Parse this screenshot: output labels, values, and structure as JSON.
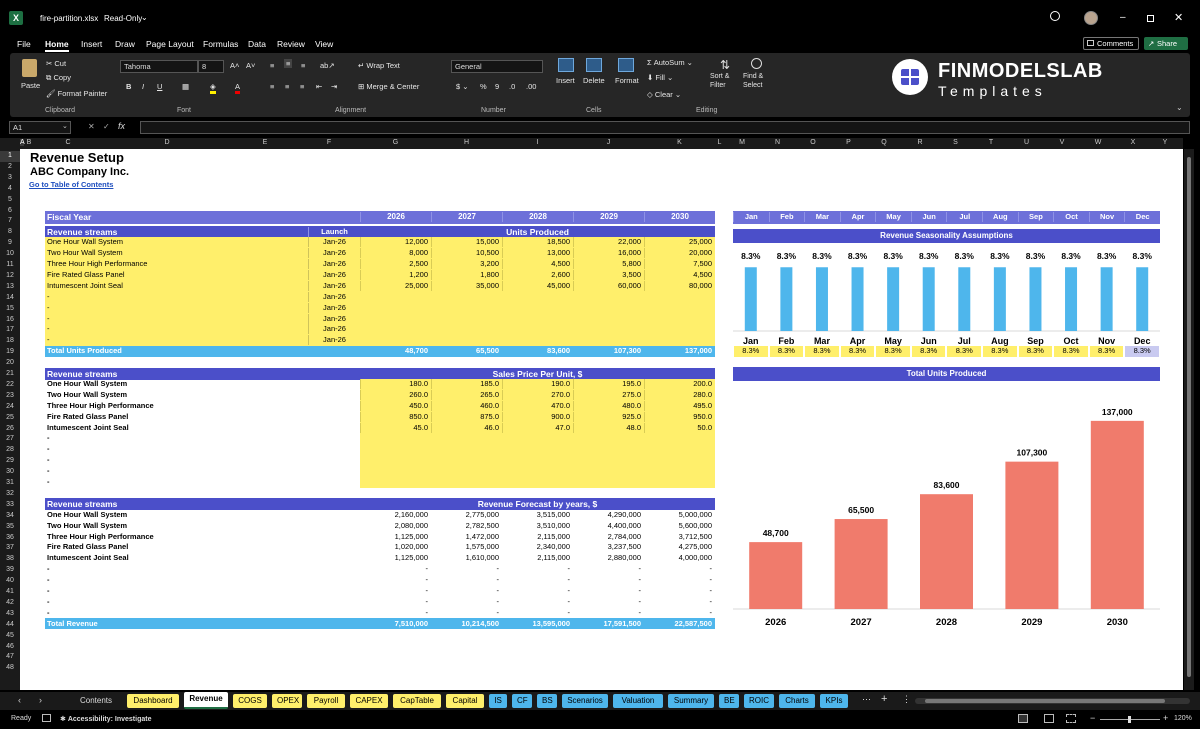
{
  "window": {
    "file_name": "fire-partition.xlsx",
    "mode": "Read-Only"
  },
  "menu": [
    "File",
    "Home",
    "Insert",
    "Draw",
    "Page Layout",
    "Formulas",
    "Data",
    "Review",
    "View"
  ],
  "actions": {
    "comments": "Comments",
    "share": "Share"
  },
  "ribbon": {
    "clipboard": {
      "paste": "Paste",
      "cut": "Cut",
      "copy": "Copy",
      "format_painter": "Format Painter",
      "label": "Clipboard"
    },
    "font": {
      "name": "Tahoma",
      "size": "8",
      "label": "Font"
    },
    "alignment": {
      "wrap_text": "Wrap Text",
      "merge_center": "Merge & Center",
      "label": "Alignment"
    },
    "number": {
      "format": "General",
      "label": "Number"
    },
    "cells": {
      "insert": "Insert",
      "delete": "Delete",
      "format": "Format",
      "label": "Cells"
    },
    "editing": {
      "autosum": "AutoSum",
      "fill": "Fill",
      "clear": "Clear",
      "sort_filter": "Sort & Filter",
      "find_select": "Find & Select",
      "label": "Editing"
    },
    "logo": {
      "brand": "FINMODELSLAB",
      "sub": "Templates"
    }
  },
  "formula_bar": {
    "name_box": "A1",
    "fx": "fx",
    "content": ""
  },
  "columns": [
    "A",
    "B",
    "C",
    "D",
    "E",
    "F",
    "G",
    "H",
    "I",
    "J",
    "K",
    "L",
    "M",
    "N",
    "O",
    "P",
    "Q",
    "R",
    "S",
    "T",
    "U",
    "V",
    "W",
    "X",
    "Y"
  ],
  "rows": [
    "1",
    "2",
    "3",
    "4",
    "5",
    "6",
    "7",
    "8",
    "9",
    "10",
    "11",
    "12",
    "13",
    "14",
    "15",
    "16",
    "17",
    "18",
    "19",
    "20",
    "21",
    "22",
    "23",
    "24",
    "25",
    "26",
    "27",
    "28",
    "29",
    "30",
    "31",
    "32",
    "33",
    "34",
    "35",
    "36",
    "37",
    "38",
    "39",
    "40",
    "41",
    "42",
    "43",
    "44",
    "45",
    "46",
    "47",
    "48"
  ],
  "sheet": {
    "title": "Revenue Setup",
    "company": "ABC Company Inc.",
    "toc_link": "Go to Table of Contents",
    "fiscal_year_label": "Fiscal Year",
    "years": [
      "2026",
      "2027",
      "2028",
      "2029",
      "2030"
    ],
    "months": [
      "Jan",
      "Feb",
      "Mar",
      "Apr",
      "May",
      "Jun",
      "Jul",
      "Aug",
      "Sep",
      "Oct",
      "Nov",
      "Dec"
    ],
    "units": {
      "header_left": "Revenue streams",
      "header_launch": "Launch",
      "header_right": "Units Produced",
      "rows": [
        {
          "name": "One Hour Wall System",
          "launch": "Jan-26",
          "values": [
            "12,000",
            "15,000",
            "18,500",
            "22,000",
            "25,000"
          ]
        },
        {
          "name": "Two Hour Wall System",
          "launch": "Jan-26",
          "values": [
            "8,000",
            "10,500",
            "13,000",
            "16,000",
            "20,000"
          ]
        },
        {
          "name": "Three Hour High Performance",
          "launch": "Jan-26",
          "values": [
            "2,500",
            "3,200",
            "4,500",
            "5,800",
            "7,500"
          ]
        },
        {
          "name": "Fire Rated Glass Panel",
          "launch": "Jan-26",
          "values": [
            "1,200",
            "1,800",
            "2,600",
            "3,500",
            "4,500"
          ]
        },
        {
          "name": "Intumescent Joint Seal",
          "launch": "Jan-26",
          "values": [
            "25,000",
            "35,000",
            "45,000",
            "60,000",
            "80,000"
          ]
        },
        {
          "name": "-",
          "launch": "Jan-26",
          "values": [
            "",
            "",
            "",
            "",
            ""
          ]
        },
        {
          "name": "-",
          "launch": "Jan-26",
          "values": [
            "",
            "",
            "",
            "",
            ""
          ]
        },
        {
          "name": "-",
          "launch": "Jan-26",
          "values": [
            "",
            "",
            "",
            "",
            ""
          ]
        },
        {
          "name": "-",
          "launch": "Jan-26",
          "values": [
            "",
            "",
            "",
            "",
            ""
          ]
        },
        {
          "name": "-",
          "launch": "Jan-26",
          "values": [
            "",
            "",
            "",
            "",
            ""
          ]
        }
      ],
      "total_label": "Total Units Produced",
      "totals": [
        "48,700",
        "65,500",
        "83,600",
        "107,300",
        "137,000"
      ]
    },
    "prices": {
      "header_left": "Revenue streams",
      "header_right": "Sales Price Per Unit, $",
      "rows": [
        {
          "name": "One Hour Wall System",
          "values": [
            "180.0",
            "185.0",
            "190.0",
            "195.0",
            "200.0"
          ]
        },
        {
          "name": "Two Hour Wall System",
          "values": [
            "260.0",
            "265.0",
            "270.0",
            "275.0",
            "280.0"
          ]
        },
        {
          "name": "Three Hour High Performance",
          "values": [
            "450.0",
            "460.0",
            "470.0",
            "480.0",
            "495.0"
          ]
        },
        {
          "name": "Fire Rated Glass Panel",
          "values": [
            "850.0",
            "875.0",
            "900.0",
            "925.0",
            "950.0"
          ]
        },
        {
          "name": "Intumescent Joint Seal",
          "values": [
            "45.0",
            "46.0",
            "47.0",
            "48.0",
            "50.0"
          ]
        },
        {
          "name": "-",
          "values": [
            "",
            "",
            "",
            "",
            ""
          ]
        },
        {
          "name": "-",
          "values": [
            "",
            "",
            "",
            "",
            ""
          ]
        },
        {
          "name": "-",
          "values": [
            "",
            "",
            "",
            "",
            ""
          ]
        },
        {
          "name": "-",
          "values": [
            "",
            "",
            "",
            "",
            ""
          ]
        },
        {
          "name": "-",
          "values": [
            "",
            "",
            "",
            "",
            ""
          ]
        }
      ]
    },
    "revenue": {
      "header_left": "Revenue streams",
      "header_right": "Revenue Forecast by years, $",
      "rows": [
        {
          "name": "One Hour Wall System",
          "values": [
            "2,160,000",
            "2,775,000",
            "3,515,000",
            "4,290,000",
            "5,000,000"
          ]
        },
        {
          "name": "Two Hour Wall System",
          "values": [
            "2,080,000",
            "2,782,500",
            "3,510,000",
            "4,400,000",
            "5,600,000"
          ]
        },
        {
          "name": "Three Hour High Performance",
          "values": [
            "1,125,000",
            "1,472,000",
            "2,115,000",
            "2,784,000",
            "3,712,500"
          ]
        },
        {
          "name": "Fire Rated Glass Panel",
          "values": [
            "1,020,000",
            "1,575,000",
            "2,340,000",
            "3,237,500",
            "4,275,000"
          ]
        },
        {
          "name": "Intumescent Joint Seal",
          "values": [
            "1,125,000",
            "1,610,000",
            "2,115,000",
            "2,880,000",
            "4,000,000"
          ]
        },
        {
          "name": "-",
          "values": [
            "-",
            "-",
            "-",
            "-",
            "-"
          ]
        },
        {
          "name": "-",
          "values": [
            "-",
            "-",
            "-",
            "-",
            "-"
          ]
        },
        {
          "name": "-",
          "values": [
            "-",
            "-",
            "-",
            "-",
            "-"
          ]
        },
        {
          "name": "-",
          "values": [
            "-",
            "-",
            "-",
            "-",
            "-"
          ]
        },
        {
          "name": "-",
          "values": [
            "-",
            "-",
            "-",
            "-",
            "-"
          ]
        }
      ],
      "total_label": "Total Revenue",
      "totals": [
        "7,510,000",
        "10,214,500",
        "13,595,000",
        "17,591,500",
        "22,587,500"
      ]
    },
    "seasonality": {
      "header": "Revenue Seasonality Assumptions",
      "values": [
        "8.3%",
        "8.3%",
        "8.3%",
        "8.3%",
        "8.3%",
        "8.3%",
        "8.3%",
        "8.3%",
        "8.3%",
        "8.3%",
        "8.3%",
        "8.3%"
      ]
    },
    "units_chart_header": "Total Units Produced"
  },
  "chart_data": [
    {
      "type": "bar",
      "categories": [
        "Jan",
        "Feb",
        "Mar",
        "Apr",
        "May",
        "Jun",
        "Jul",
        "Aug",
        "Sep",
        "Oct",
        "Nov",
        "Dec"
      ],
      "values": [
        8.3,
        8.3,
        8.3,
        8.3,
        8.3,
        8.3,
        8.3,
        8.3,
        8.3,
        8.3,
        8.3,
        8.3
      ],
      "data_labels": [
        "8.3%",
        "8.3%",
        "8.3%",
        "8.3%",
        "8.3%",
        "8.3%",
        "8.3%",
        "8.3%",
        "8.3%",
        "8.3%",
        "8.3%",
        "8.3%"
      ],
      "color": "#4eb6ec",
      "ylim": [
        0,
        10
      ]
    },
    {
      "type": "bar",
      "categories": [
        "2026",
        "2027",
        "2028",
        "2029",
        "2030"
      ],
      "values": [
        48700,
        65500,
        83600,
        107300,
        137000
      ],
      "data_labels": [
        "48,700",
        "65,500",
        "83,600",
        "107,300",
        "137,000"
      ],
      "color": "#f07b6c",
      "ylim": [
        0,
        150000
      ]
    }
  ],
  "tabs": [
    "Contents",
    "Dashboard",
    "Revenue",
    "COGS",
    "OPEX",
    "Payroll",
    "CAPEX",
    "CapTable",
    "Capital",
    "IS",
    "CF",
    "BS",
    "Scenarios",
    "Valuation",
    "Summary",
    "BE",
    "ROIC",
    "Charts",
    "KPIs"
  ],
  "active_tab": "Revenue",
  "status": {
    "ready": "Ready",
    "accessibility": "Accessibility: Investigate",
    "zoom": "120%"
  },
  "colors": {
    "header_band": "#4b4fc9",
    "input_yellow": "#ffef6b",
    "total_blue": "#4eb6ec",
    "units_bar": "#f07b6c"
  }
}
